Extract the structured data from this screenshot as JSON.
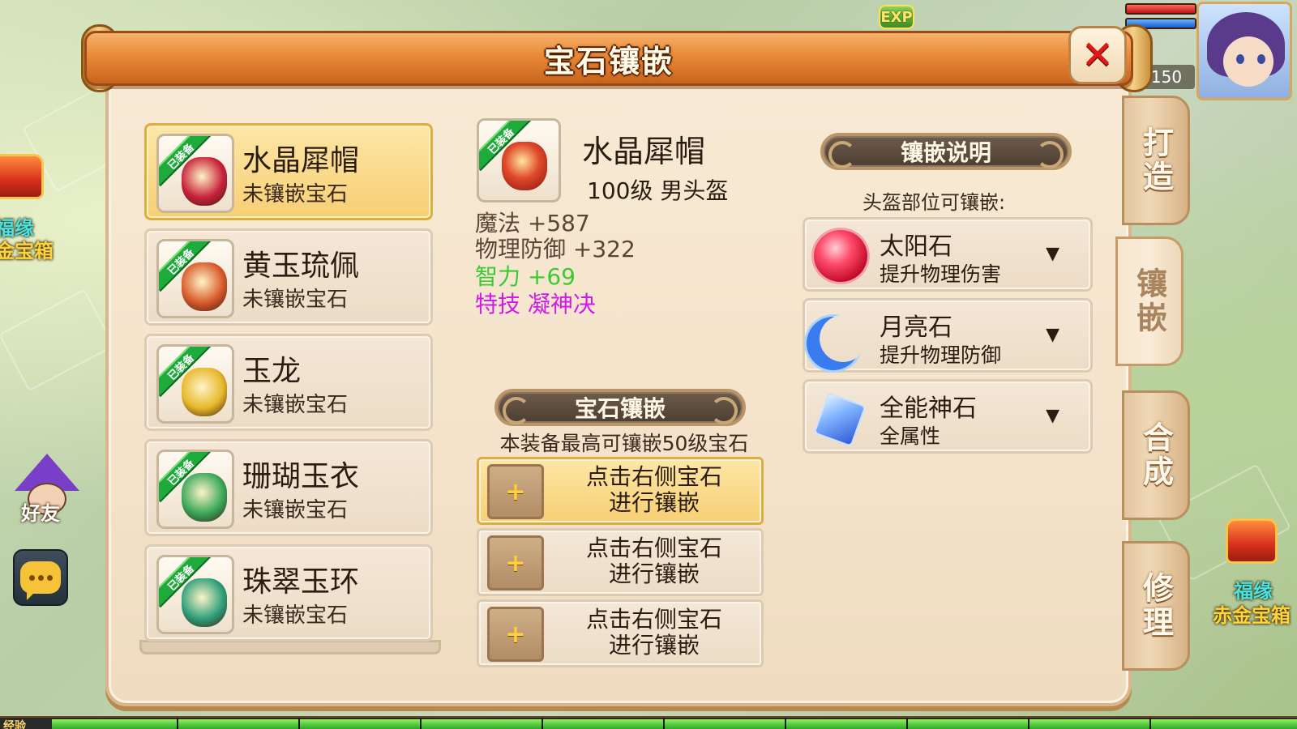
{
  "hud": {
    "exp_badge": "EXP",
    "level": "150",
    "exp_label": "经验",
    "exp_progress": 1.0
  },
  "world": {
    "left_chest_label_top": "福缘",
    "left_chest_label_bottom": "金宝箱",
    "right_chest_label_top": "福缘",
    "right_chest_label_bottom": "赤金宝箱",
    "friend_label": "好友"
  },
  "panel": {
    "title": "宝石镶嵌",
    "close_icon": "close-icon"
  },
  "equipment_list": [
    {
      "badge": "已装备",
      "name": "水晶犀帽",
      "status": "未镶嵌宝石",
      "active": true,
      "color": "#c8223a"
    },
    {
      "badge": "已装备",
      "name": "黄玉琉佩",
      "status": "未镶嵌宝石",
      "active": false,
      "color": "#d95a2a"
    },
    {
      "badge": "已装备",
      "name": "玉龙",
      "status": "未镶嵌宝石",
      "active": false,
      "color": "#e6b82a"
    },
    {
      "badge": "已装备",
      "name": "珊瑚玉衣",
      "status": "未镶嵌宝石",
      "active": false,
      "color": "#3aa85a"
    },
    {
      "badge": "已装备",
      "name": "珠翠玉环",
      "status": "未镶嵌宝石",
      "active": false,
      "color": "#2fa07a"
    }
  ],
  "detail": {
    "badge": "已装备",
    "name": "水晶犀帽",
    "level_type": "100级  男头盔",
    "stats": [
      {
        "text": "魔法  +587",
        "style": "base"
      },
      {
        "text": "物理防御  +322",
        "style": "base"
      },
      {
        "text": "智力  +69",
        "style": "green"
      },
      {
        "text": "特技  凝神决",
        "style": "purple"
      }
    ]
  },
  "inlay": {
    "banner": "宝石镶嵌",
    "note": "本装备最高可镶嵌50级宝石",
    "slots": [
      {
        "plus": "+",
        "line1": "点击右侧宝石",
        "line2": "进行镶嵌",
        "active": true
      },
      {
        "plus": "+",
        "line1": "点击右侧宝石",
        "line2": "进行镶嵌",
        "active": false
      },
      {
        "plus": "+",
        "line1": "点击右侧宝石",
        "line2": "进行镶嵌",
        "active": false
      }
    ]
  },
  "gem_info": {
    "banner": "镶嵌说明",
    "hint": "头盔部位可镶嵌:",
    "gems": [
      {
        "name": "太阳石",
        "effect": "提升物理伤害",
        "arrow": "▼",
        "icon": "sun-stone-icon"
      },
      {
        "name": "月亮石",
        "effect": "提升物理防御",
        "arrow": "▼",
        "icon": "moon-stone-icon"
      },
      {
        "name": "全能神石",
        "effect": "全属性",
        "arrow": "▼",
        "icon": "omni-stone-icon"
      }
    ]
  },
  "side_tabs": [
    {
      "label": "打造",
      "active": false
    },
    {
      "label": "镶嵌",
      "active": true
    },
    {
      "label": "合成",
      "active": false
    },
    {
      "label": "修理",
      "active": false
    }
  ]
}
